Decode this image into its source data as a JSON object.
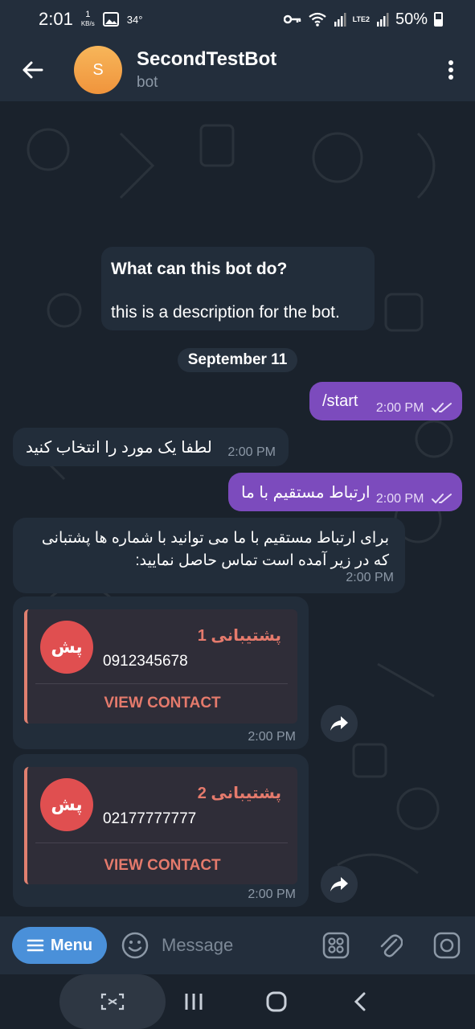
{
  "status": {
    "time": "2:01",
    "net_speed_value": "1",
    "net_speed_unit": "KB/s",
    "temperature": "34°",
    "network_label": "LTE2",
    "battery": "50%"
  },
  "header": {
    "avatar_letter": "S",
    "title": "SecondTestBot",
    "subtitle": "bot"
  },
  "info_card": {
    "title": "What can this bot do?",
    "text": "this is a description for the bot."
  },
  "date_label": "September 11",
  "messages": [
    {
      "direction": "out",
      "text": "/start",
      "time": "2:00 PM"
    },
    {
      "direction": "in",
      "text": "لطفا یک مورد را انتخاب کنید",
      "time": "2:00 PM"
    },
    {
      "direction": "out",
      "text": "ارتباط مستقیم با ما",
      "time": "2:00 PM"
    },
    {
      "direction": "in",
      "text_line1": "برای ارتباط مستقیم با ما می توانید با شماره ها پشتبانی",
      "text_line2": "که در زیر آمده است تماس حاصل نمایید:",
      "time": "2:00 PM"
    }
  ],
  "contacts": [
    {
      "avatar": "پش",
      "name": "پشتیبانی 1",
      "phone": "0912345678",
      "action": "VIEW CONTACT",
      "time": "2:00 PM"
    },
    {
      "avatar": "پش",
      "name": "پشتیبانی 2",
      "phone": "02177777777",
      "action": "VIEW CONTACT",
      "time": "2:00 PM"
    }
  ],
  "input_bar": {
    "menu_label": "Menu",
    "placeholder": "Message"
  },
  "colors": {
    "header_bg": "#232e3c",
    "chat_bg": "#1a222c",
    "outgoing_bubble": "#7c4bbd",
    "incoming_bubble": "#222d3a",
    "menu_button": "#4a90d9",
    "contact_accent": "#e57a6c",
    "contact_avatar": "#e04f50",
    "avatar_orange": "#f0943c"
  }
}
